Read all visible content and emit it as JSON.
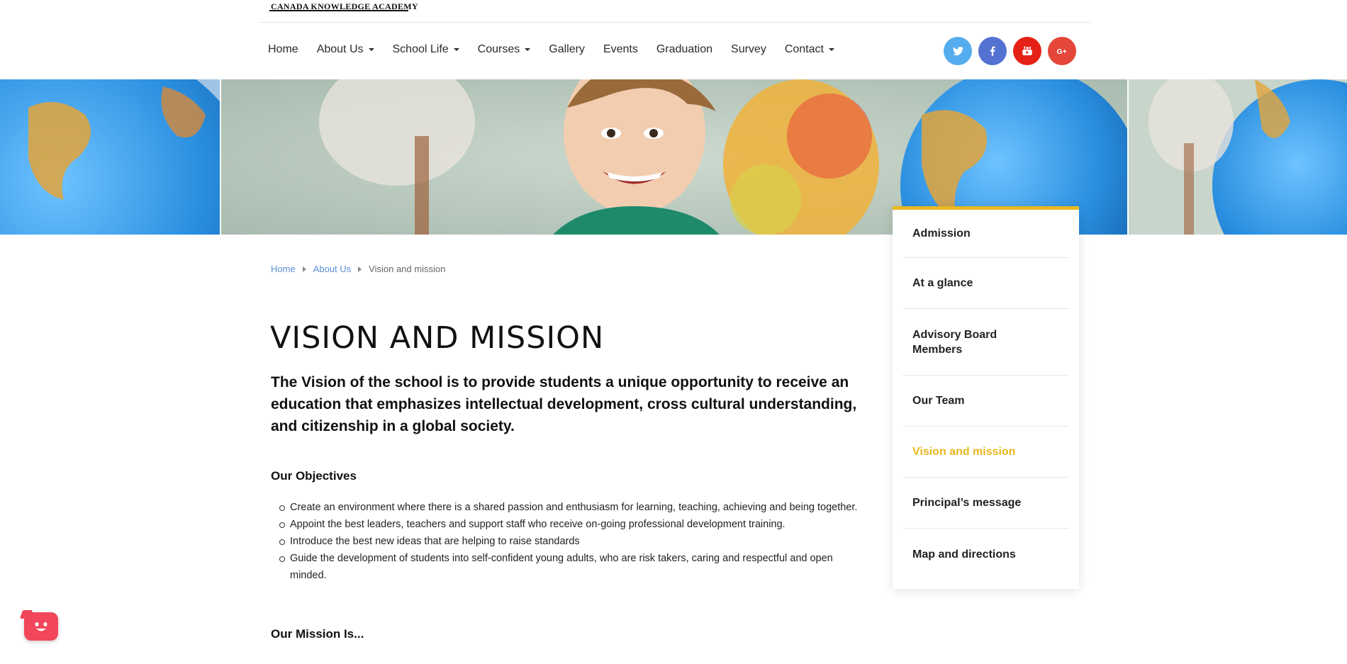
{
  "header": {
    "logo_text": "CANADA KNOWLEDGE ACADEMY"
  },
  "nav": {
    "items": [
      {
        "label": "Home",
        "dropdown": false
      },
      {
        "label": "About Us",
        "dropdown": true
      },
      {
        "label": "School Life",
        "dropdown": true
      },
      {
        "label": "Courses",
        "dropdown": true
      },
      {
        "label": "Gallery",
        "dropdown": false
      },
      {
        "label": "Events",
        "dropdown": false
      },
      {
        "label": "Graduation",
        "dropdown": false
      },
      {
        "label": "Survey",
        "dropdown": false
      },
      {
        "label": "Contact",
        "dropdown": true
      }
    ]
  },
  "social": [
    {
      "name": "twitter-icon",
      "color": "#55acee"
    },
    {
      "name": "facebook-icon",
      "color": "#5472d2"
    },
    {
      "name": "youtube-icon",
      "color": "#e52117"
    },
    {
      "name": "google-plus-icon",
      "color": "#e4463a"
    }
  ],
  "breadcrumb": {
    "home": "Home",
    "parent": "About Us",
    "current": "Vision and mission"
  },
  "main": {
    "title": "VISION AND MISSION",
    "vision": "The Vision of the school is to provide students a unique opportunity to receive an education that emphasizes intellectual development, cross cultural understanding, and citizenship in a global society.",
    "objectives_heading": "Our Objectives",
    "objectives": [
      "Create an environment where there is a shared passion and enthusiasm for learning, teaching, achieving and being together.",
      "Appoint the best leaders, teachers and support staff who receive on-going professional development training.",
      "Introduce the best new ideas that are helping to raise standards",
      "Guide the development of students into self-confident young adults, who are risk takers, caring and respectful and open minded."
    ],
    "mission_heading": "Our Mission Is..."
  },
  "sidebar": {
    "accent": "#e8b820",
    "items": [
      {
        "label": "Admission"
      },
      {
        "label": "At a glance"
      },
      {
        "label": "Advisory Board Members"
      },
      {
        "label": "Our Team"
      },
      {
        "label": "Vision and mission"
      },
      {
        "label": "Principal’s message"
      },
      {
        "label": "Map and directions"
      }
    ],
    "active": "Vision and mission"
  },
  "chat_widget": {
    "icon": "chat-bot-icon",
    "color": "#f2465a"
  }
}
